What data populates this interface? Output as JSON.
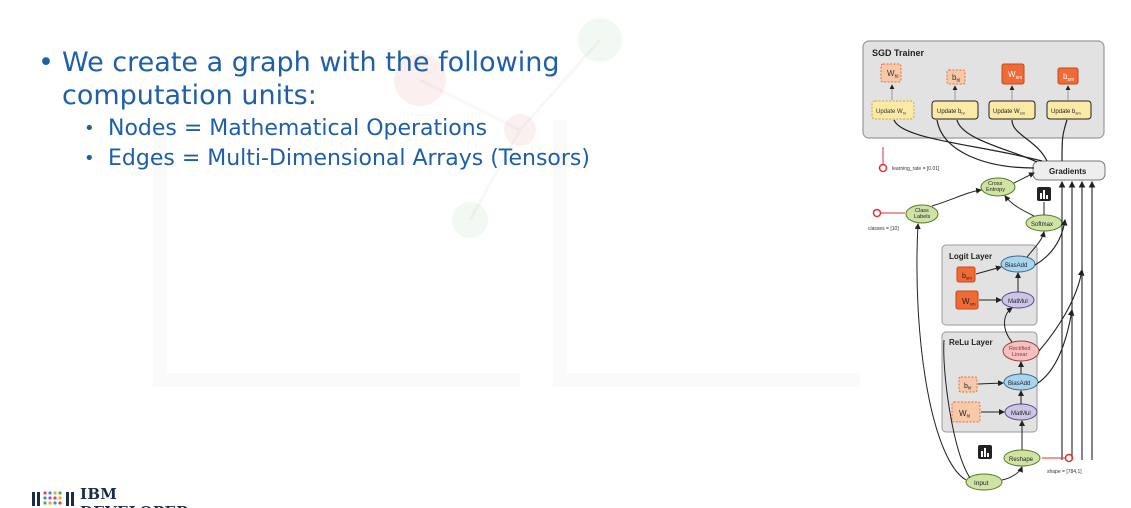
{
  "slide": {
    "bullet_main": "We create a graph with the following computation units:",
    "sub_bullets": [
      "Nodes = Mathematical Operations",
      "Edges = Multi-Dimensional Arrays (Tensors)"
    ],
    "bullet_glyph": "•"
  },
  "logo": {
    "text": "IBM DEVELOPER"
  },
  "diagram": {
    "sgd_title": "SGD Trainer",
    "params": [
      "W",
      "b",
      "W",
      "b"
    ],
    "param_subs": [
      "hl",
      "hl",
      "sm",
      "sm"
    ],
    "updates": [
      "Update W",
      "Update b",
      "Update W",
      "Update b"
    ],
    "update_subs": [
      "hl",
      "hl",
      "sm",
      "sm"
    ],
    "learning_rate": "learning_rate = [0.01]",
    "gradients": "Gradients",
    "cross_entropy": [
      "Cross",
      "Entropy"
    ],
    "class_labels": [
      "Class",
      "Labels"
    ],
    "classes": "classes = [10]",
    "softmax": "Softmax",
    "logit_title": "Logit Layer",
    "relu_title": "ReLu Layer",
    "biasadd": "BiasAdd",
    "matmul": "MatMul",
    "rectified": [
      "Rectified",
      "Linear"
    ],
    "logit_b": "b",
    "logit_b_sub": "sm",
    "logit_w": "W",
    "logit_w_sub": "sm",
    "relu_b": "b",
    "relu_b_sub": "hl",
    "relu_w": "W",
    "relu_w_sub": "hl",
    "reshape": "Reshape",
    "shape": "shape = [784,1]",
    "input": "Input"
  },
  "colors": {
    "bullet_text": "#1f5fa8",
    "param_orange": "#ef6a35",
    "param_light": "#f7c9a8",
    "update_yellow": "#fbe9a6",
    "op_green": "#cfe3a4",
    "op_blue": "#a9d4ee",
    "op_purple": "#cdc4e6",
    "op_pink": "#f4c1c1",
    "panel_gray": "#e2e2e2"
  }
}
